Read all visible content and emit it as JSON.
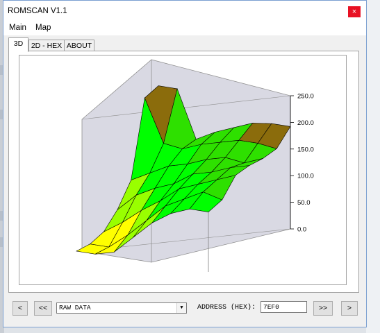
{
  "window": {
    "title": "ROMSCAN V1.1",
    "close_glyph": "×"
  },
  "menu": [
    {
      "label": "Main"
    },
    {
      "label": "Map"
    }
  ],
  "tabs": [
    {
      "label": "3D",
      "active": true
    },
    {
      "label": "2D - HEX"
    },
    {
      "label": "ABOUT"
    }
  ],
  "chart_data": {
    "type": "surface3d",
    "z_ticks": [
      "250.0",
      "200.0",
      "150.0",
      "100.0",
      "50.0",
      "0.0"
    ],
    "zlim": [
      0,
      250
    ],
    "grid": [
      [
        120,
        130,
        165,
        170,
        170,
        175,
        205
      ],
      [
        120,
        140,
        150,
        160,
        155,
        180,
        205
      ],
      [
        105,
        120,
        135,
        145,
        160,
        180,
        200
      ],
      [
        80,
        100,
        120,
        135,
        150,
        170,
        185
      ],
      [
        45,
        65,
        90,
        110,
        135,
        160,
        170
      ],
      [
        10,
        30,
        65,
        95,
        125,
        145,
        150
      ],
      [
        0,
        0,
        35,
        75,
        105,
        150,
        245
      ],
      [
        0,
        0,
        10,
        40,
        85,
        235,
        245
      ]
    ],
    "colormap": [
      "#ffff00",
      "#99ff00",
      "#00ff00",
      "#2ee000",
      "#8b6c0c"
    ]
  },
  "toolbar": {
    "first_label": "<",
    "prev_label": "<<",
    "mode_value": "RAW DATA",
    "address_label": "ADDRESS (HEX):",
    "address_value": "7EF0",
    "next_label": ">>",
    "last_label": ">"
  },
  "icons": {
    "dropdown": "chevron-down-icon"
  }
}
